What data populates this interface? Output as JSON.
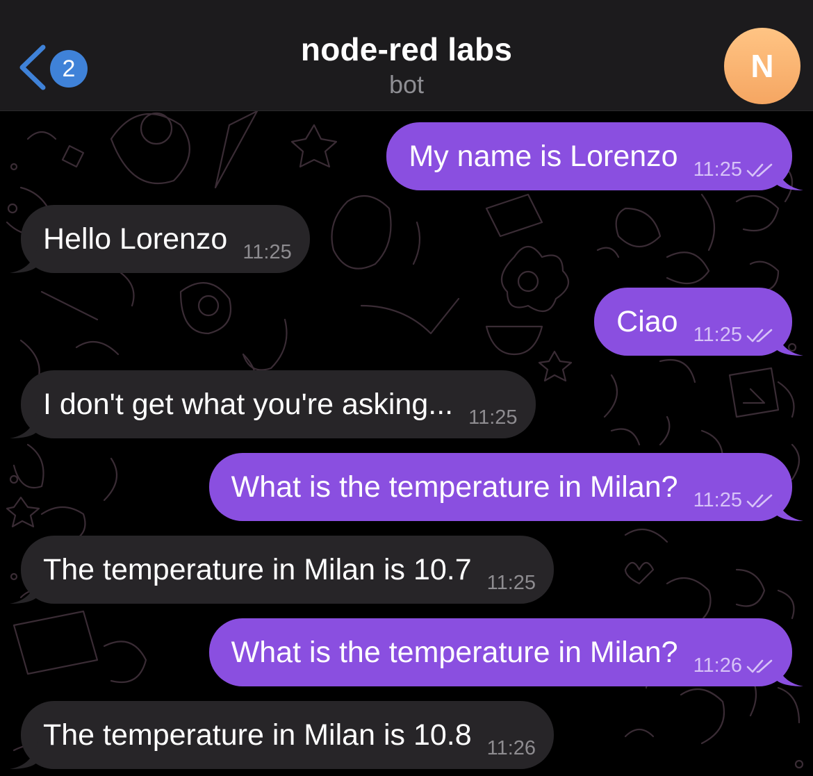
{
  "header": {
    "back_badge": "2",
    "title": "node-red labs",
    "subtitle": "bot",
    "avatar_letter": "N"
  },
  "colors": {
    "header_bg": "#1c1b1d",
    "outgoing_bubble": "#8a4fe0",
    "incoming_bubble": "#272528",
    "badge": "#3f82d8",
    "avatar": "#f5a662"
  },
  "icons": {
    "back": "chevron-left-icon",
    "read_status": "double-check-icon"
  },
  "messages": [
    {
      "direction": "out",
      "text": "My name is Lorenzo",
      "time": "11:25",
      "read": true
    },
    {
      "direction": "in",
      "text": "Hello Lorenzo",
      "time": "11:25"
    },
    {
      "direction": "out",
      "text": "Ciao",
      "time": "11:25",
      "read": true
    },
    {
      "direction": "in",
      "text": "I don't get what you're asking...",
      "time": "11:25"
    },
    {
      "direction": "out",
      "text": "What is the temperature in Milan?",
      "time": "11:25",
      "read": true
    },
    {
      "direction": "in",
      "text": "The temperature in Milan is 10.7",
      "time": "11:25"
    },
    {
      "direction": "out",
      "text": "What is the temperature in Milan?",
      "time": "11:26",
      "read": true
    },
    {
      "direction": "in",
      "text": "The temperature in Milan is 10.8",
      "time": "11:26"
    }
  ]
}
